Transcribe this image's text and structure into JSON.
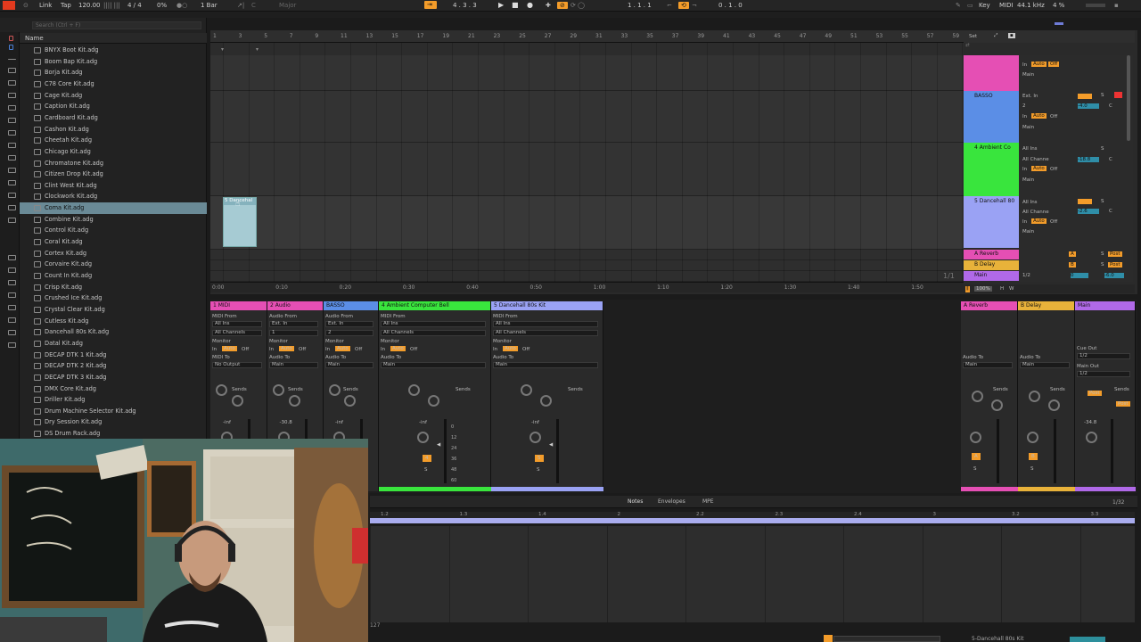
{
  "transport": {
    "link": "Link",
    "tap": "Tap",
    "tempo": "120.00",
    "signature": "4 / 4",
    "cpu_pct": "0%",
    "quantize": "1 Bar",
    "key": "C",
    "scale": "Major",
    "position": "4 . 3 . 3",
    "loop_start": "1 . 1 . 1",
    "loop_len": "0 . 1 . 0",
    "key_label": "Key",
    "midi_label": "MIDI",
    "sample_rate": "44.1 kHz",
    "cpu_load": "4 %"
  },
  "browser": {
    "search_placeholder": "Search (Ctrl + F)",
    "column_name": "Name",
    "items": [
      "BNYX Boot Kit.adg",
      "Boom Bap Kit.adg",
      "Borja Kit.adg",
      "C78 Core Kit.adg",
      "Cage Kit.adg",
      "Caption Kit.adg",
      "Cardboard Kit.adg",
      "Cashon Kit.adg",
      "Cheetah Kit.adg",
      "Chicago Kit.adg",
      "Chromatone Kit.adg",
      "Citizen Drop Kit.adg",
      "Clint West Kit.adg",
      "Clockwork Kit.adg",
      "Coma Kit.adg",
      "Combine Kit.adg",
      "Control Kit.adg",
      "Coral Kit.adg",
      "Cortex Kit.adg",
      "Corvaire Kit.adg",
      "Count In Kit.adg",
      "Crisp Kit.adg",
      "Crushed Ice Kit.adg",
      "Crystal Clear Kit.adg",
      "Cutless Kit.adg",
      "Dancehall 80s Kit.adg",
      "Datal Kit.adg",
      "DECAP DTK 1 Kit.adg",
      "DECAP DTK 2 Kit.adg",
      "DECAP DTK 3 Kit.adg",
      "DMX Core Kit.adg",
      "Driller Kit.adg",
      "Drum Machine Selector Kit.adg",
      "Dry Session Kit.adg",
      "DS Drum Rack.adg"
    ],
    "selected_index": 14
  },
  "arrangement": {
    "bar_ticks": [
      "1",
      "3",
      "5",
      "7",
      "9",
      "11",
      "13",
      "15",
      "17",
      "19",
      "21",
      "23",
      "25",
      "27",
      "29",
      "31",
      "33",
      "35",
      "37",
      "39",
      "41",
      "43",
      "45",
      "47",
      "49",
      "51",
      "53",
      "55",
      "57",
      "59"
    ],
    "time_ticks": [
      "0:00",
      "0:10",
      "0:20",
      "0:30",
      "0:40",
      "0:50",
      "1:00",
      "1:10",
      "1:20",
      "1:30",
      "1:40",
      "1:50"
    ],
    "clip_name": "5 Dancehal",
    "page_counter": "1/1",
    "set_label": "Set",
    "tracks": [
      {
        "name": "",
        "color": "#e54fb4"
      },
      {
        "name": "BASSO",
        "color": "#5b8ee6"
      },
      {
        "name": "4 Ambient Co",
        "color": "#39e53d"
      },
      {
        "name": "5 Dancehall 80",
        "color": "#9aa2f4"
      }
    ],
    "returns": [
      {
        "name": "A Reverb",
        "color": "#e54fb4"
      },
      {
        "name": "B Delay",
        "color": "#e8b23a"
      },
      {
        "name": "Main",
        "color": "#b069e8"
      }
    ],
    "io": {
      "ext_in": "Ext. In",
      "all_ins": "All Ins",
      "all_channels": "All Channe",
      "in": "In",
      "auto": "Auto",
      "off": "Off",
      "main": "Main",
      "ch2": "2",
      "vol_basso": "-4.0",
      "vol_amb": "-18.8",
      "vol_dance": "-2.6",
      "send_A": "A",
      "send_B": "B",
      "post": "Post",
      "half": "1/2",
      "zoom": "100%",
      "num": "0",
      "main_vol": "-6.0"
    }
  },
  "mixer": {
    "strips": [
      {
        "title": "1 MIDI",
        "color": "#e54fb4",
        "from_label": "MIDI From",
        "from": "All Ins",
        "ch": "All Channels",
        "monitor": "Monitor",
        "to_label": "MIDI To",
        "to": "No Output",
        "vol": "-inf",
        "num": ""
      },
      {
        "title": "2 Audio",
        "color": "#e54fb4",
        "from_label": "Audio From",
        "from": "Ext. In",
        "ch": "1",
        "monitor": "Monitor",
        "to_label": "Audio To",
        "to": "Main",
        "vol": "-30.8",
        "num": ""
      },
      {
        "title": "BASSO",
        "color": "#5b8ee6",
        "from_label": "Audio From",
        "from": "Ext. In",
        "ch": "2",
        "monitor": "Monitor",
        "to_label": "Audio To",
        "to": "Main",
        "vol": "-inf",
        "num": ""
      },
      {
        "title": "4 Ambient Computer Bell",
        "color": "#39e53d",
        "from_label": "MIDI From",
        "from": "All Ins",
        "ch": "All Channels",
        "monitor": "Monitor",
        "to_label": "Audio To",
        "to": "Main",
        "vol": "-inf",
        "num": "4"
      },
      {
        "title": "5 Dancehall 80s Kit",
        "color": "#9aa2f4",
        "from_label": "MIDI From",
        "from": "All Ins",
        "ch": "All Channels",
        "monitor": "Monitor",
        "to_label": "Audio To",
        "to": "Main",
        "vol": "-inf",
        "num": "5"
      }
    ],
    "returns": [
      {
        "title": "A Reverb",
        "color": "#e54fb4",
        "to_label": "Audio To",
        "to": "Main",
        "letter": "A"
      },
      {
        "title": "B Delay",
        "color": "#e8b23a",
        "to_label": "Audio To",
        "to": "Main",
        "letter": "B"
      },
      {
        "title": "Main",
        "color": "#b069e8",
        "cue_label": "Cue Out",
        "cue": "1/2",
        "out_label": "Main Out",
        "out": "1/2",
        "vol": "-34.8"
      }
    ],
    "sends_label": "Sends",
    "in": "In",
    "auto": "Auto",
    "off": "Off",
    "s": "S",
    "post": "Post",
    "scale": [
      "0",
      "12",
      "24",
      "36",
      "48",
      "60"
    ]
  },
  "clip_editor": {
    "tabs": [
      "Notes",
      "Envelopes",
      "MPE"
    ],
    "grid": "1/32",
    "ruler": [
      "1.2",
      "1.3",
      "1.4",
      "2",
      "2.2",
      "2.3",
      "2.4",
      "3",
      "3.2",
      "3.3"
    ],
    "velocity_max": "127",
    "bottom_track": "5-Dancehall 80s Kit"
  }
}
